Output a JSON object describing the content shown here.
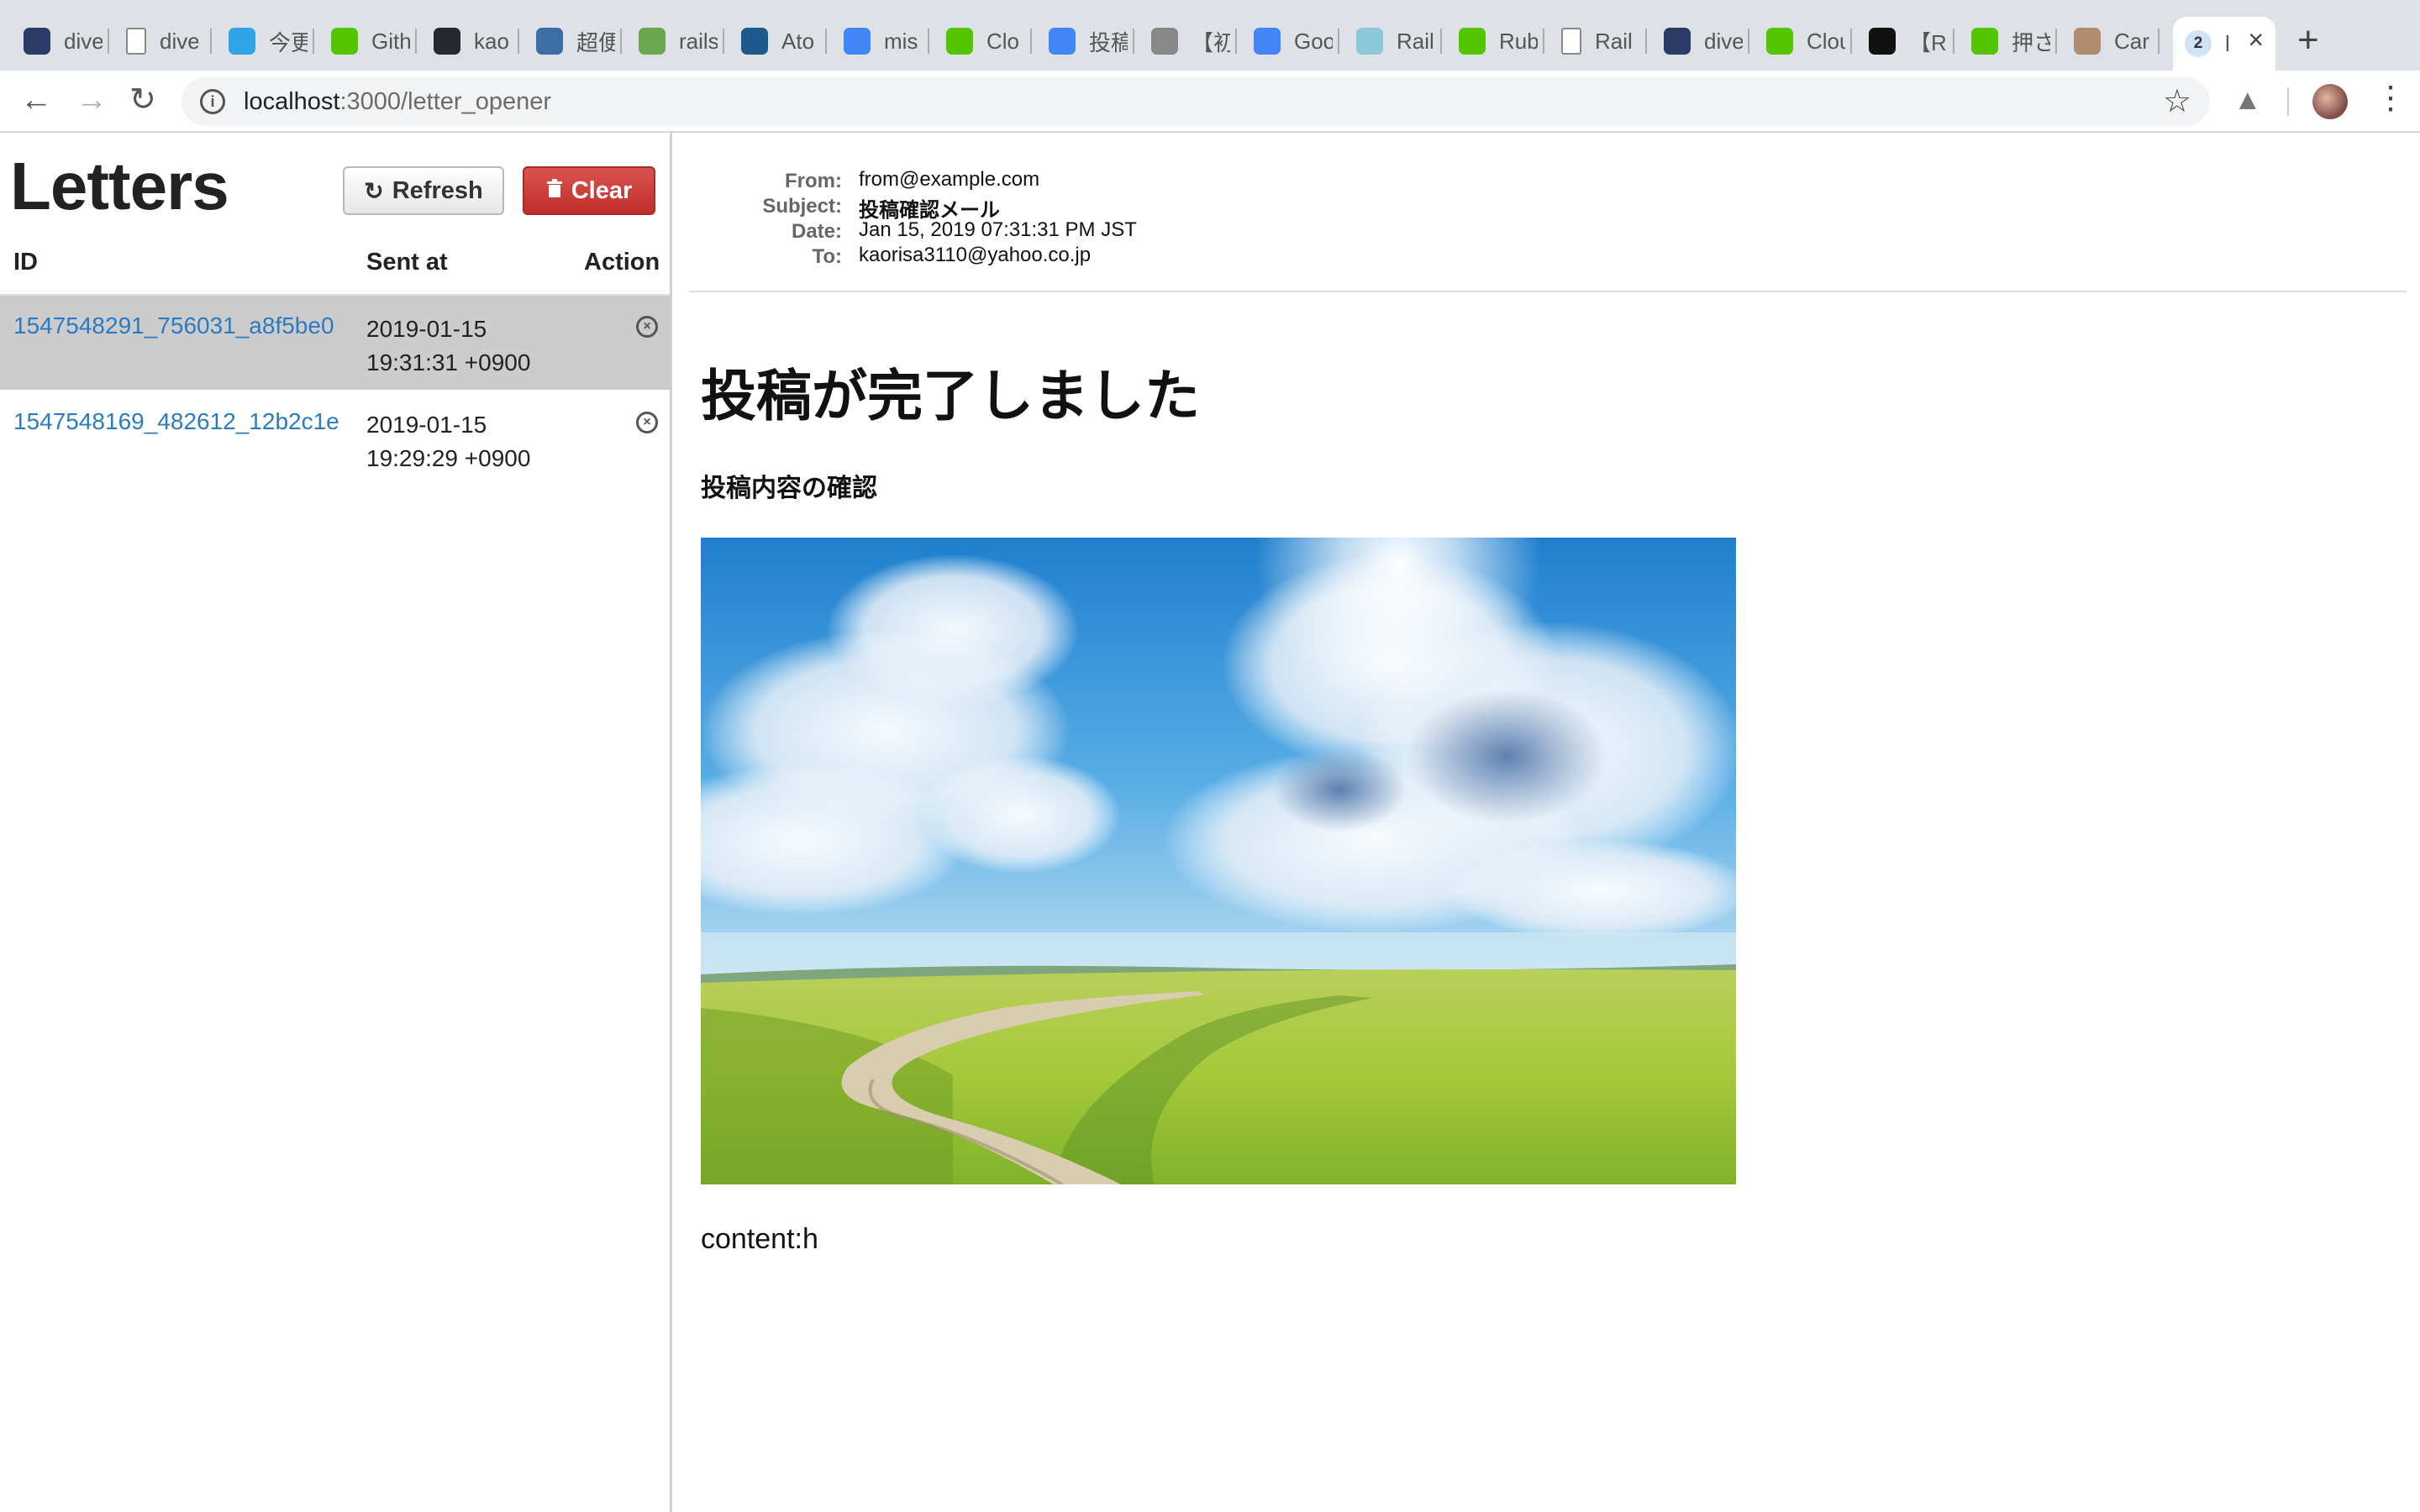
{
  "browser": {
    "tabs": [
      {
        "label": "dive",
        "icon": "diveintocode-icon",
        "color": "#2b3a67"
      },
      {
        "label": "dive",
        "icon": "document-icon",
        "color": "#ffffff"
      },
      {
        "label": "今更",
        "icon": "circle-logo-icon",
        "color": "#2fa4e7"
      },
      {
        "label": "Gith",
        "icon": "qiita-icon",
        "color": "#55c500"
      },
      {
        "label": "kao",
        "icon": "github-icon",
        "color": "#24292e"
      },
      {
        "label": "超便",
        "icon": "code-brackets-icon",
        "color": "#3b6ea5"
      },
      {
        "label": "rails",
        "icon": "frog-icon",
        "color": "#6aa84f"
      },
      {
        "label": "Ato",
        "icon": "atom-icon",
        "color": "#1e5a8c"
      },
      {
        "label": "mis",
        "icon": "google-icon",
        "color": "#4285f4"
      },
      {
        "label": "Clo",
        "icon": "qiita-icon",
        "color": "#55c500"
      },
      {
        "label": "投稿",
        "icon": "google-icon",
        "color": "#4285f4"
      },
      {
        "label": "【初",
        "icon": "slash-icon",
        "color": "#888888"
      },
      {
        "label": "Goo",
        "icon": "google-translate-icon",
        "color": "#4285f4"
      },
      {
        "label": "Rail",
        "icon": "image-icon",
        "color": "#8cc8d8"
      },
      {
        "label": "Rub",
        "icon": "qiita-icon",
        "color": "#55c500"
      },
      {
        "label": "Rail",
        "icon": "document-icon",
        "color": "#ffffff"
      },
      {
        "label": "dive",
        "icon": "diveintocode-icon",
        "color": "#2b3a67"
      },
      {
        "label": "Clou",
        "icon": "qiita-icon",
        "color": "#55c500"
      },
      {
        "label": "【R",
        "icon": "triangle-icon",
        "color": "#111111"
      },
      {
        "label": "押さ",
        "icon": "qiita-icon",
        "color": "#55c500"
      },
      {
        "label": "Car",
        "icon": "photo-icon",
        "color": "#b08c70"
      },
      {
        "label": "l",
        "icon": "letter-opener-icon",
        "color": "#d0e4f5",
        "badge": "2"
      }
    ],
    "url": {
      "host": "localhost",
      "path": ":3000/letter_opener"
    }
  },
  "letters": {
    "title": "Letters",
    "refresh_label": "Refresh",
    "clear_label": "Clear",
    "columns": {
      "id": "ID",
      "sent_at": "Sent at",
      "action": "Action"
    },
    "rows": [
      {
        "id": "1547548291_756031_a8f5be0",
        "date": "2019-01-15",
        "time": "19:31:31 +0900",
        "selected": true
      },
      {
        "id": "1547548169_482612_12b2c1e",
        "date": "2019-01-15",
        "time": "19:29:29 +0900",
        "selected": false
      }
    ]
  },
  "message": {
    "headers": {
      "from_label": "From:",
      "from": "from@example.com",
      "subject_label": "Subject:",
      "subject": "投稿確認メール",
      "date_label": "Date:",
      "date": "Jan 15, 2019 07:31:31 PM JST",
      "to_label": "To:",
      "to": "kaorisa3110@yahoo.co.jp"
    },
    "heading": "投稿が完了しました",
    "subheading": "投稿内容の確認",
    "body": "content:h"
  }
}
